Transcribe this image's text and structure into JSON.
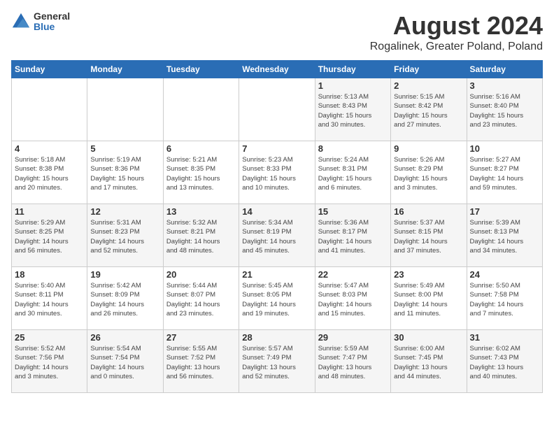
{
  "logo": {
    "general": "General",
    "blue": "Blue"
  },
  "title": "August 2024",
  "subtitle": "Rogalinek, Greater Poland, Poland",
  "days_of_week": [
    "Sunday",
    "Monday",
    "Tuesday",
    "Wednesday",
    "Thursday",
    "Friday",
    "Saturday"
  ],
  "weeks": [
    [
      {
        "day": "",
        "info": ""
      },
      {
        "day": "",
        "info": ""
      },
      {
        "day": "",
        "info": ""
      },
      {
        "day": "",
        "info": ""
      },
      {
        "day": "1",
        "info": "Sunrise: 5:13 AM\nSunset: 8:43 PM\nDaylight: 15 hours\nand 30 minutes."
      },
      {
        "day": "2",
        "info": "Sunrise: 5:15 AM\nSunset: 8:42 PM\nDaylight: 15 hours\nand 27 minutes."
      },
      {
        "day": "3",
        "info": "Sunrise: 5:16 AM\nSunset: 8:40 PM\nDaylight: 15 hours\nand 23 minutes."
      }
    ],
    [
      {
        "day": "4",
        "info": "Sunrise: 5:18 AM\nSunset: 8:38 PM\nDaylight: 15 hours\nand 20 minutes."
      },
      {
        "day": "5",
        "info": "Sunrise: 5:19 AM\nSunset: 8:36 PM\nDaylight: 15 hours\nand 17 minutes."
      },
      {
        "day": "6",
        "info": "Sunrise: 5:21 AM\nSunset: 8:35 PM\nDaylight: 15 hours\nand 13 minutes."
      },
      {
        "day": "7",
        "info": "Sunrise: 5:23 AM\nSunset: 8:33 PM\nDaylight: 15 hours\nand 10 minutes."
      },
      {
        "day": "8",
        "info": "Sunrise: 5:24 AM\nSunset: 8:31 PM\nDaylight: 15 hours\nand 6 minutes."
      },
      {
        "day": "9",
        "info": "Sunrise: 5:26 AM\nSunset: 8:29 PM\nDaylight: 15 hours\nand 3 minutes."
      },
      {
        "day": "10",
        "info": "Sunrise: 5:27 AM\nSunset: 8:27 PM\nDaylight: 14 hours\nand 59 minutes."
      }
    ],
    [
      {
        "day": "11",
        "info": "Sunrise: 5:29 AM\nSunset: 8:25 PM\nDaylight: 14 hours\nand 56 minutes."
      },
      {
        "day": "12",
        "info": "Sunrise: 5:31 AM\nSunset: 8:23 PM\nDaylight: 14 hours\nand 52 minutes."
      },
      {
        "day": "13",
        "info": "Sunrise: 5:32 AM\nSunset: 8:21 PM\nDaylight: 14 hours\nand 48 minutes."
      },
      {
        "day": "14",
        "info": "Sunrise: 5:34 AM\nSunset: 8:19 PM\nDaylight: 14 hours\nand 45 minutes."
      },
      {
        "day": "15",
        "info": "Sunrise: 5:36 AM\nSunset: 8:17 PM\nDaylight: 14 hours\nand 41 minutes."
      },
      {
        "day": "16",
        "info": "Sunrise: 5:37 AM\nSunset: 8:15 PM\nDaylight: 14 hours\nand 37 minutes."
      },
      {
        "day": "17",
        "info": "Sunrise: 5:39 AM\nSunset: 8:13 PM\nDaylight: 14 hours\nand 34 minutes."
      }
    ],
    [
      {
        "day": "18",
        "info": "Sunrise: 5:40 AM\nSunset: 8:11 PM\nDaylight: 14 hours\nand 30 minutes."
      },
      {
        "day": "19",
        "info": "Sunrise: 5:42 AM\nSunset: 8:09 PM\nDaylight: 14 hours\nand 26 minutes."
      },
      {
        "day": "20",
        "info": "Sunrise: 5:44 AM\nSunset: 8:07 PM\nDaylight: 14 hours\nand 23 minutes."
      },
      {
        "day": "21",
        "info": "Sunrise: 5:45 AM\nSunset: 8:05 PM\nDaylight: 14 hours\nand 19 minutes."
      },
      {
        "day": "22",
        "info": "Sunrise: 5:47 AM\nSunset: 8:03 PM\nDaylight: 14 hours\nand 15 minutes."
      },
      {
        "day": "23",
        "info": "Sunrise: 5:49 AM\nSunset: 8:00 PM\nDaylight: 14 hours\nand 11 minutes."
      },
      {
        "day": "24",
        "info": "Sunrise: 5:50 AM\nSunset: 7:58 PM\nDaylight: 14 hours\nand 7 minutes."
      }
    ],
    [
      {
        "day": "25",
        "info": "Sunrise: 5:52 AM\nSunset: 7:56 PM\nDaylight: 14 hours\nand 3 minutes."
      },
      {
        "day": "26",
        "info": "Sunrise: 5:54 AM\nSunset: 7:54 PM\nDaylight: 14 hours\nand 0 minutes."
      },
      {
        "day": "27",
        "info": "Sunrise: 5:55 AM\nSunset: 7:52 PM\nDaylight: 13 hours\nand 56 minutes."
      },
      {
        "day": "28",
        "info": "Sunrise: 5:57 AM\nSunset: 7:49 PM\nDaylight: 13 hours\nand 52 minutes."
      },
      {
        "day": "29",
        "info": "Sunrise: 5:59 AM\nSunset: 7:47 PM\nDaylight: 13 hours\nand 48 minutes."
      },
      {
        "day": "30",
        "info": "Sunrise: 6:00 AM\nSunset: 7:45 PM\nDaylight: 13 hours\nand 44 minutes."
      },
      {
        "day": "31",
        "info": "Sunrise: 6:02 AM\nSunset: 7:43 PM\nDaylight: 13 hours\nand 40 minutes."
      }
    ]
  ]
}
